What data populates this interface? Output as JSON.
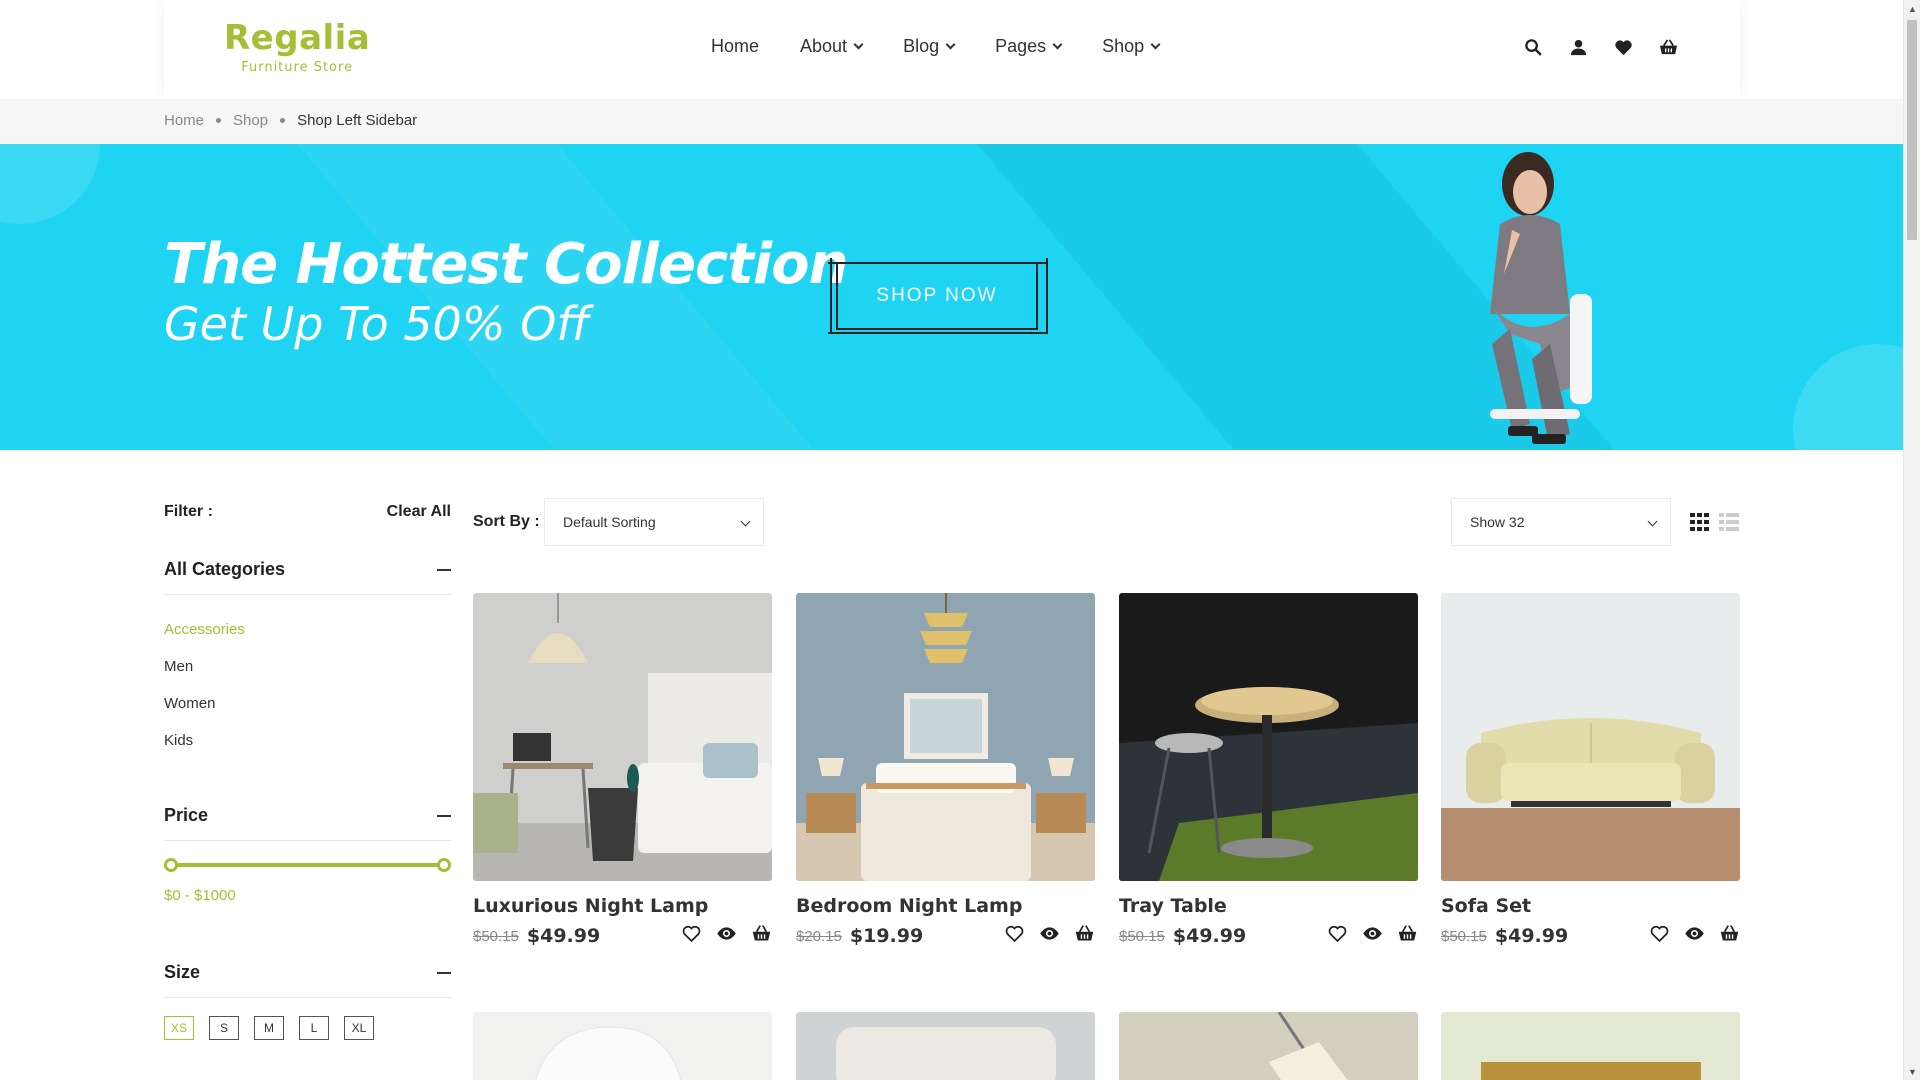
{
  "brand": {
    "name": "Regalia",
    "tagline": "Furniture Store",
    "accent": "#a5be35"
  },
  "nav": [
    {
      "label": "Home",
      "dropdown": false
    },
    {
      "label": "About",
      "dropdown": true
    },
    {
      "label": "Blog",
      "dropdown": true
    },
    {
      "label": "Pages",
      "dropdown": true
    },
    {
      "label": "Shop",
      "dropdown": true
    }
  ],
  "header_icons": [
    "search-icon",
    "user-icon",
    "heart-icon",
    "basket-icon"
  ],
  "breadcrumb": {
    "home": "Home",
    "shop": "Shop",
    "current": "Shop Left Sidebar"
  },
  "banner": {
    "title": "The Hottest Collection",
    "subtitle": "Get Up To 50% Off",
    "button": "SHOP NOW",
    "color": "#1fd3f2"
  },
  "filter": {
    "label": "Filter :",
    "clear": "Clear All",
    "categories_title": "All Categories",
    "categories": [
      "Accessories",
      "Men",
      "Women",
      "Kids"
    ],
    "active_category": "Accessories",
    "price_title": "Price",
    "price_range": "$0 - $1000",
    "size_title": "Size",
    "sizes": [
      "XS",
      "S",
      "M",
      "L",
      "XL"
    ],
    "active_size": "XS"
  },
  "toolbar": {
    "sort_label": "Sort By :",
    "sort_value": "Default Sorting",
    "show_value": "Show 32",
    "active_view": "grid"
  },
  "products": [
    {
      "name": "Luxurious Night Lamp",
      "old_price": "$50.15",
      "price": "$49.99"
    },
    {
      "name": "Bedroom Night Lamp",
      "old_price": "$20.15",
      "price": "$19.99"
    },
    {
      "name": "Tray Table",
      "old_price": "$50.15",
      "price": "$49.99"
    },
    {
      "name": "Sofa Set",
      "old_price": "$50.15",
      "price": "$49.99"
    }
  ]
}
